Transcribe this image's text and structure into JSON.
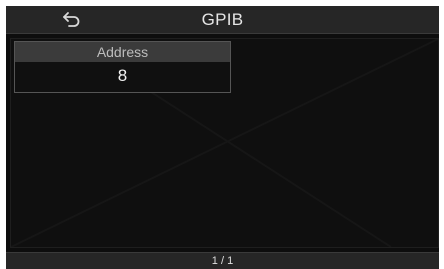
{
  "header": {
    "title": "GPIB",
    "back_icon": "back-arrow-icon"
  },
  "parameters": [
    {
      "label": "Address",
      "value": "8"
    }
  ],
  "footer": {
    "page": "1 / 1"
  }
}
